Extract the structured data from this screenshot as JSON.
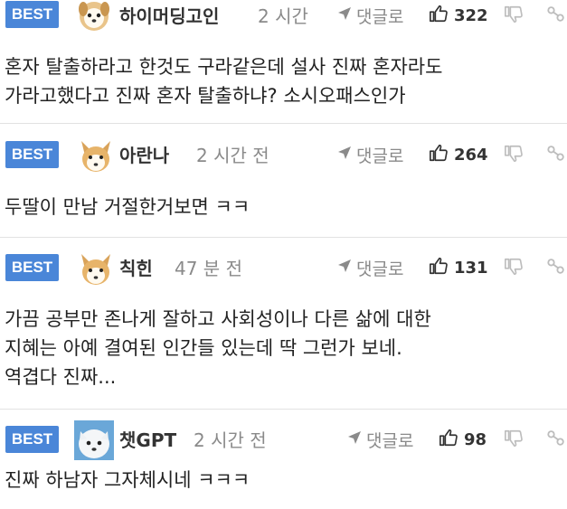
{
  "colors": {
    "best_badge": "#4a86d8",
    "meta_gray": "#8a8a8a",
    "divider": "#e2e2e2"
  },
  "comments": [
    {
      "badge": "BEST",
      "avatar_icon": "puppy-avatar-icon",
      "nickname": "하이머딩고인",
      "time": "2 시간",
      "reply_label": "댓글로",
      "likes": "322",
      "body": "혼자 탈출하라고 한것도 구라같은데 설사 진짜 혼자라도\n가라고했다고 진짜 혼자 탈출하냐? 소시오패스인가"
    },
    {
      "badge": "BEST",
      "avatar_icon": "puppy-avatar-icon",
      "nickname": "아란나",
      "time": "2 시간 전",
      "reply_label": "댓글로",
      "likes": "264",
      "body": "두딸이 만남 거절한거보면 ㅋㅋ"
    },
    {
      "badge": "BEST",
      "avatar_icon": "puppy-avatar-icon",
      "nickname": "칙힌",
      "time": "47 분 전",
      "reply_label": "댓글로",
      "likes": "131",
      "body": "가끔 공부만 존나게 잘하고 사회성이나 다른 삶에 대한\n지혜는 아예 결여된 인간들 있는데 딱 그런가 보네.\n역겹다 진짜..."
    },
    {
      "badge": "BEST",
      "avatar_icon": "white-dog-photo-avatar-icon",
      "nickname": "챗GPT",
      "time": "2 시간 전",
      "reply_label": "댓글로",
      "likes": "98",
      "body": "진짜 하남자 그자체시네 ㅋㅋㅋ"
    }
  ]
}
